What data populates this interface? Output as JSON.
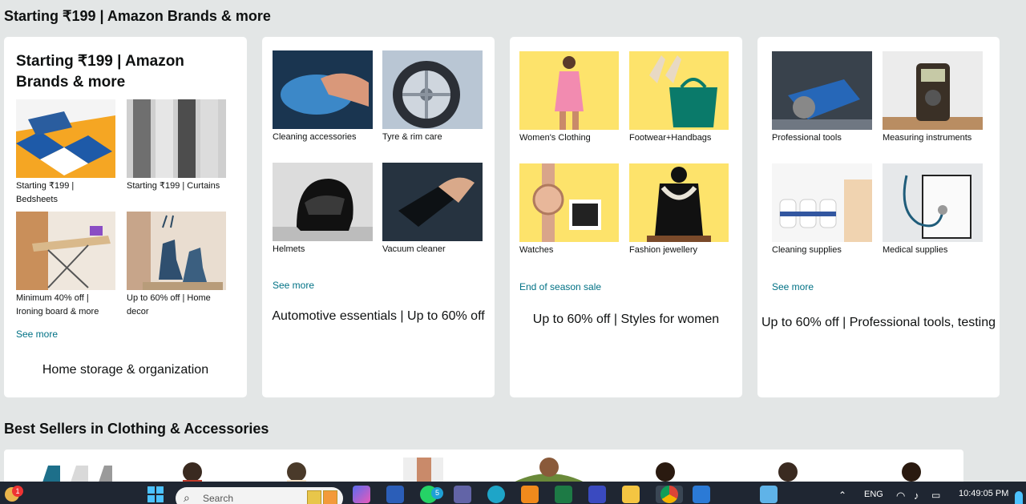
{
  "sections": {
    "title1": "Starting ₹199 | Amazon Brands & more",
    "title2": "Best Sellers in Clothing & Accessories"
  },
  "card1": {
    "heading": "Starting ₹199 | Amazon Brands & more",
    "tiles": [
      {
        "caption": "Starting ₹199 | Bedsheets"
      },
      {
        "caption": "Starting ₹199 | Curtains"
      },
      {
        "caption": "Minimum 40% off | Ironing board & more"
      },
      {
        "caption": "Up to 60% off | Home decor"
      }
    ],
    "see_more": "See more",
    "footer": "Home storage & organization"
  },
  "card2": {
    "tiles": [
      {
        "caption": "Cleaning accessories"
      },
      {
        "caption": "Tyre & rim care"
      },
      {
        "caption": "Helmets"
      },
      {
        "caption": "Vacuum cleaner"
      }
    ],
    "see_more": "See more",
    "footer": "Automotive essentials | Up to 60% off"
  },
  "card3": {
    "tiles": [
      {
        "caption": "Women's Clothing"
      },
      {
        "caption": "Footwear+Handbags"
      },
      {
        "caption": "Watches"
      },
      {
        "caption": "Fashion jewellery"
      }
    ],
    "see_more": "End of season sale",
    "footer": "Up to 60% off | Styles for women"
  },
  "card4": {
    "tiles": [
      {
        "caption": "Professional tools"
      },
      {
        "caption": "Measuring instruments"
      },
      {
        "caption": "Cleaning supplies"
      },
      {
        "caption": "Medical supplies"
      }
    ],
    "see_more": "See more",
    "footer": "Up to 60% off | Professional tools, testing"
  },
  "taskbar": {
    "search_placeholder": "Search",
    "language": "ENG",
    "time": "10:49:05 PM",
    "notification_badge": "1",
    "whatsapp_badge": "5"
  },
  "colors": {
    "link": "#007185",
    "page_bg": "#e3e6e6",
    "taskbar": "#1f2632"
  }
}
